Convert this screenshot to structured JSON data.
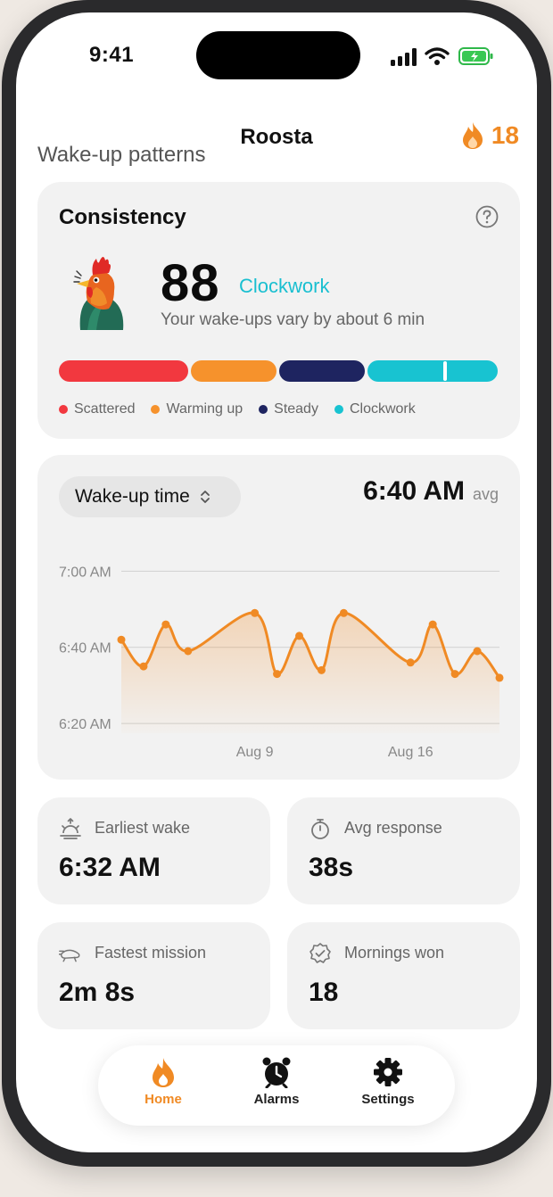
{
  "status": {
    "time": "9:41"
  },
  "header": {
    "app_title": "Roosta",
    "streak_count": "18"
  },
  "section_title": "Wake-up patterns",
  "consistency": {
    "title": "Consistency",
    "score": "88",
    "label": "Clockwork",
    "description": "Your wake-ups vary by about 6 min",
    "scale_position": 0.88,
    "legend": [
      {
        "label": "Scattered",
        "color": "#f2383f"
      },
      {
        "label": "Warming up",
        "color": "#f6922c"
      },
      {
        "label": "Steady",
        "color": "#1e2460"
      },
      {
        "label": "Clockwork",
        "color": "#18c3d1"
      }
    ]
  },
  "wake_chart": {
    "metric_label": "Wake-up time",
    "avg_value": "6:40 AM",
    "avg_unit": "avg"
  },
  "chart_data": {
    "type": "area",
    "y_tick_labels": [
      "7:00 AM",
      "6:40 AM",
      "6:20 AM"
    ],
    "x_tick_labels": [
      "Aug 9",
      "Aug 16"
    ],
    "ylim_minutes_after_6am": [
      13,
      65
    ],
    "grid": true,
    "color": "#f08a24",
    "series": [
      {
        "x_day": [
          3,
          4,
          5,
          6,
          9,
          10,
          11,
          12,
          13,
          16,
          17,
          18,
          19,
          20
        ],
        "y_minutes_after_6am": [
          42,
          35,
          46,
          39,
          49,
          33,
          43,
          34,
          49,
          36,
          46,
          33,
          39,
          32
        ]
      }
    ]
  },
  "stats": [
    {
      "label": "Earliest wake",
      "value": "6:32 AM",
      "icon": "sunrise-icon"
    },
    {
      "label": "Avg response",
      "value": "38s",
      "icon": "stopwatch-icon"
    },
    {
      "label": "Fastest mission",
      "value": "2m 8s",
      "icon": "running-icon"
    },
    {
      "label": "Mornings won",
      "value": "18",
      "icon": "badge-check-icon"
    }
  ],
  "tabs": [
    {
      "label": "Home",
      "icon": "flame-icon",
      "active": true
    },
    {
      "label": "Alarms",
      "icon": "alarm-clock-icon",
      "active": false
    },
    {
      "label": "Settings",
      "icon": "gear-icon",
      "active": false
    }
  ]
}
